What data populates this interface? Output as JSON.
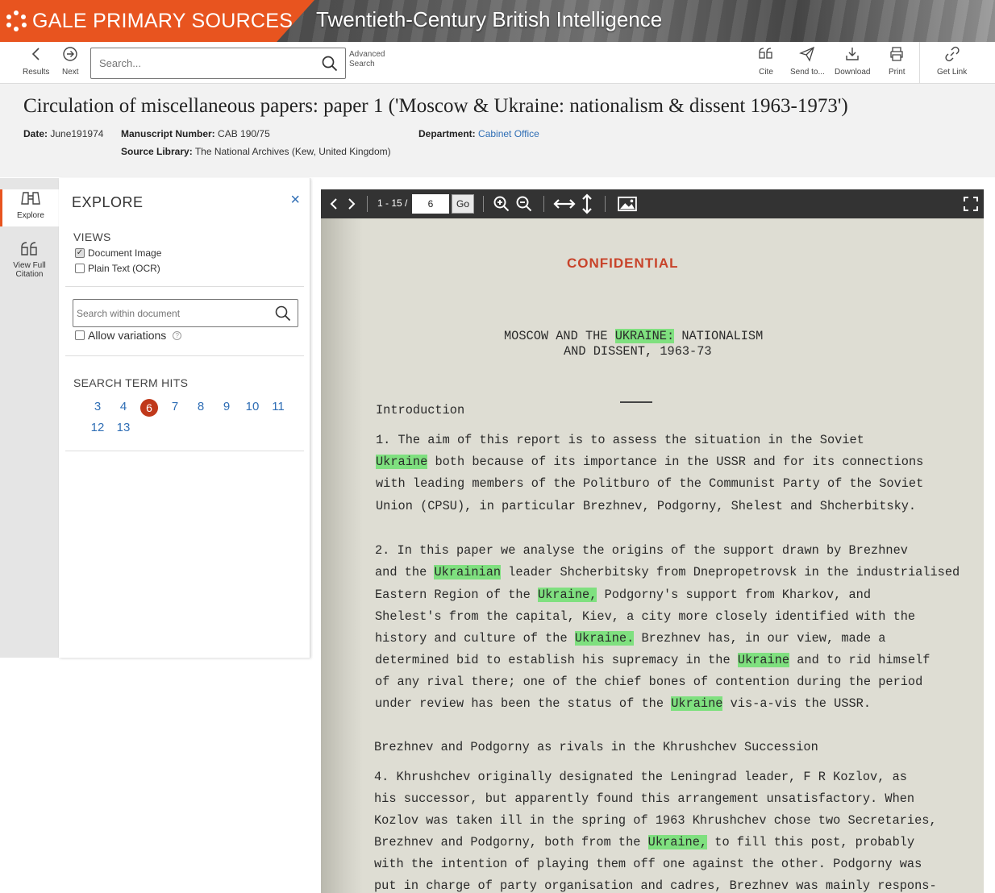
{
  "banner": {
    "brand": "GALE PRIMARY SOURCES",
    "collection": "Twentieth-Century British Intelligence"
  },
  "toolbar": {
    "results": "Results",
    "next": "Next",
    "search_placeholder": "Search...",
    "advanced_line1": "Advanced",
    "advanced_line2": "Search",
    "cite": "Cite",
    "send_to": "Send to...",
    "download": "Download",
    "print": "Print",
    "get_link": "Get Link"
  },
  "document": {
    "title": "Circulation of miscellaneous papers: paper 1 ('Moscow & Ukraine: nationalism & dissent 1963-1973')",
    "date_label": "Date:",
    "date": "June191974",
    "manuscript_label": "Manuscript Number:",
    "manuscript": "CAB 190/75",
    "department_label": "Department:",
    "department": "Cabinet Office",
    "source_label": "Source Library:",
    "source": "The National Archives (Kew, United Kingdom)"
  },
  "rail": {
    "explore": "Explore",
    "citation_line1": "View Full",
    "citation_line2": "Citation"
  },
  "explore": {
    "title": "EXPLORE",
    "views_label": "VIEWS",
    "view_image": "Document Image",
    "view_ocr": "Plain Text (OCR)",
    "within_placeholder": "Search within document",
    "allow_variations": "Allow variations",
    "hits_label": "SEARCH TERM HITS",
    "hits": [
      "3",
      "4",
      "6",
      "7",
      "8",
      "9",
      "10",
      "11",
      "12",
      "13"
    ],
    "active_hit": "6"
  },
  "viewer": {
    "range": "1 - 15 /",
    "page": "6",
    "go": "Go"
  },
  "page_text": {
    "confidential": "CONFIDENTIAL",
    "h1a": "MOSCOW AND THE ",
    "h1b": "UKRAINE:",
    "h1c": "  NATIONALISM",
    "h2": "AND DISSENT, 1963-73",
    "intro": "Introduction",
    "p1_1": "1.   The aim of this report is to assess the situation in the Soviet",
    "p1_2a": "Ukraine",
    "p1_2b": " both because of its importance in the USSR and for its connections",
    "p1_3": "with leading members of the Politburo of the Communist Party of the Soviet",
    "p1_4": "Union (CPSU), in particular Brezhnev, Podgorny, Shelest and Shcherbitsky.",
    "p2_1": "2.   In this paper we analyse the origins of the support drawn by Brezhnev",
    "p2_2a": "and the ",
    "p2_2b": "Ukrainian",
    "p2_2c": " leader Shcherbitsky from Dnepropetrovsk in the industrialised",
    "p2_3a": "Eastern Region of the ",
    "p2_3b": "Ukraine,",
    "p2_3c": " Podgorny's support from Kharkov, and",
    "p2_4": "Shelest's from the capital, Kiev, a city more closely identified with the",
    "p2_5a": "history and culture of the ",
    "p2_5b": "Ukraine.",
    "p2_5c": "   Brezhnev has, in our view, made a",
    "p2_6a": "determined bid to establish his supremacy in the ",
    "p2_6b": "Ukraine",
    "p2_6c": " and to rid himself",
    "p2_7": "of any rival there;  one of the chief bones of contention during the period",
    "p2_8a": "under review has been the status of the ",
    "p2_8b": "Ukraine",
    "p2_8c": " vis-a-vis the USSR.",
    "sub": "Brezhnev and Podgorny as rivals in the Khrushchev Succession",
    "p4_1": "4.   Khrushchev originally designated the Leningrad leader, F R Kozlov, as",
    "p4_2": "his successor, but apparently found this arrangement unsatisfactory.   When",
    "p4_3": "Kozlov was taken ill in the spring of 1963 Khrushchev chose two Secretaries,",
    "p4_4a": "Brezhnev and Podgorny, both from the ",
    "p4_4b": "Ukraine,",
    "p4_4c": " to fill this post, probably",
    "p4_5": "with the intention of playing them off one against the other.   Podgorny was",
    "p4_6": "put in charge of party organisation and cadres, Brezhnev was mainly respons-"
  },
  "colors": {
    "brand_orange": "#e8541f",
    "link_blue": "#2f6eb5",
    "hit_active": "#c0391b",
    "highlight_green": "#7fe07f",
    "confidential_red": "#c8432a"
  }
}
